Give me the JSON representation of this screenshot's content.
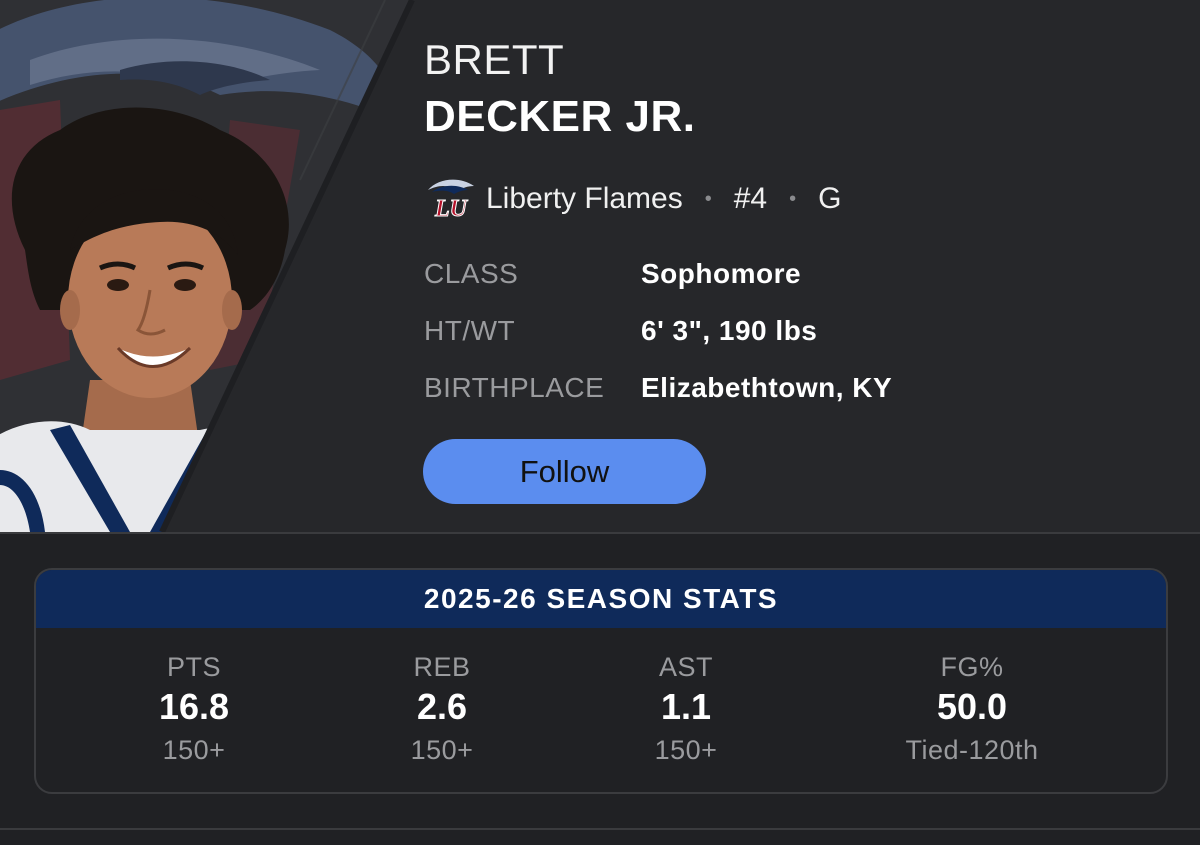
{
  "player": {
    "first_name": "BRETT",
    "last_name": "DECKER JR.",
    "team": "Liberty Flames",
    "number": "#4",
    "position": "G",
    "team_logo_text": "LU"
  },
  "info": [
    {
      "label": "CLASS",
      "value": "Sophomore"
    },
    {
      "label": "HT/WT",
      "value": "6' 3\", 190 lbs"
    },
    {
      "label": "BIRTHPLACE",
      "value": "Elizabethtown, KY"
    }
  ],
  "follow_label": "Follow",
  "stats": {
    "title": "2025-26 SEASON STATS",
    "items": [
      {
        "label": "PTS",
        "value": "16.8",
        "rank": "150+"
      },
      {
        "label": "REB",
        "value": "2.6",
        "rank": "150+"
      },
      {
        "label": "AST",
        "value": "1.1",
        "rank": "150+"
      },
      {
        "label": "FG%",
        "value": "50.0",
        "rank": "Tied-120th"
      }
    ]
  },
  "colors": {
    "background": "#202124",
    "header_background": "#26272a",
    "follow_button": "#5b8def",
    "stats_header": "#0f2a5a",
    "label_gray": "#9a9b9e",
    "team_red": "#b5122b",
    "team_navy": "#0f2a5a"
  },
  "icons": [
    "player-headshot",
    "liberty-eagle-logo",
    "team-logo-icon"
  ]
}
